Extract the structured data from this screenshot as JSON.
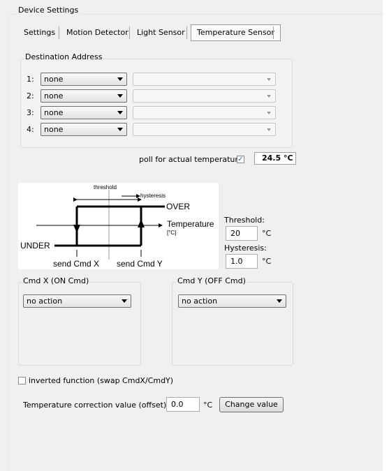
{
  "group_title": "Device Settings",
  "tabs": [
    {
      "label": "Settings"
    },
    {
      "label": "Motion Detector"
    },
    {
      "label": "Light Sensor"
    },
    {
      "label": "Temperature Sensor",
      "active": true
    }
  ],
  "destination": {
    "title": "Destination Address",
    "rows": [
      {
        "num": "1:",
        "value": "none"
      },
      {
        "num": "2:",
        "value": "none"
      },
      {
        "num": "3:",
        "value": "none"
      },
      {
        "num": "4:",
        "value": "none"
      }
    ]
  },
  "poll": {
    "label": "poll for actual temperature:",
    "checked": true,
    "reading": "24.5 °C"
  },
  "diagram": {
    "threshold": "threshold",
    "hysteresis": "hysteresis",
    "over": "OVER",
    "under": "UNDER",
    "temperature": "Temperature",
    "unit": "[°C]",
    "send_x": "send Cmd X",
    "send_y": "send Cmd Y"
  },
  "threshold": {
    "label": "Threshold:",
    "value": "20",
    "unit": "°C"
  },
  "hysteresis": {
    "label": "Hysteresis:",
    "value": "1.0",
    "unit": "°C"
  },
  "cmd_x": {
    "title": "Cmd X  (ON Cmd)",
    "value": "no action"
  },
  "cmd_y": {
    "title": "Cmd Y  (OFF Cmd)",
    "value": "no action"
  },
  "inverted": {
    "label": "inverted function (swap CmdX/CmdY)",
    "checked": false
  },
  "correction": {
    "label": "Temperature correction value (offset):",
    "value": "0.0",
    "unit": "°C",
    "button": "Change value"
  }
}
